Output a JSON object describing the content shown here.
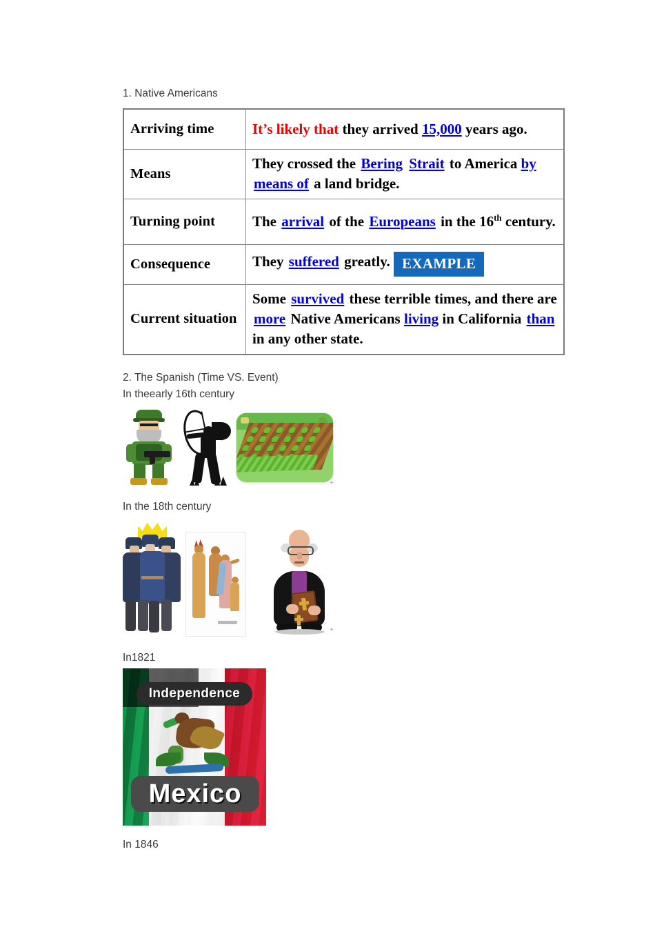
{
  "document": {
    "section1": {
      "heading": "1. Native Americans",
      "table": {
        "rows": [
          {
            "label": "Arriving time",
            "segments": [
              {
                "text": "It’s likely that",
                "style": "red-bold"
              },
              {
                "text": " they arrived ",
                "style": "plain"
              },
              {
                "text": "15,000",
                "style": "blank"
              },
              {
                "text": " years ago.",
                "style": "plain"
              }
            ]
          },
          {
            "label": "Means",
            "segments": [
              {
                "text": "They crossed the ",
                "style": "plain"
              },
              {
                "text": "Bering",
                "style": "blank"
              },
              {
                "text": " ",
                "style": "plain"
              },
              {
                "text": "Strait",
                "style": "blank"
              },
              {
                "text": " to America ",
                "style": "plain"
              },
              {
                "text": "by",
                "style": "blank"
              },
              {
                "text": "  ",
                "style": "plain"
              },
              {
                "text": "means of",
                "style": "blank"
              },
              {
                "text": " a land bridge.",
                "style": "plain"
              }
            ]
          },
          {
            "label": "Turning point",
            "segments": [
              {
                "text": "The ",
                "style": "plain"
              },
              {
                "text": "arrival",
                "style": "blank"
              },
              {
                "text": " of the ",
                "style": "plain"
              },
              {
                "text": "Europeans",
                "style": "blank"
              },
              {
                "text": " in the 16",
                "style": "plain"
              },
              {
                "text": "th",
                "style": "superscript"
              },
              {
                "text": " century.",
                "style": "plain"
              }
            ]
          },
          {
            "label": "Consequence",
            "segments": [
              {
                "text": "They ",
                "style": "plain"
              },
              {
                "text": "suffered",
                "style": "blank"
              },
              {
                "text": " greatly. ",
                "style": "plain"
              },
              {
                "text": "EXAMPLE",
                "style": "badge"
              }
            ]
          },
          {
            "label": "Current situation",
            "segments": [
              {
                "text": "Some ",
                "style": "plain"
              },
              {
                "text": "survived",
                "style": "blank"
              },
              {
                "text": " these terrible times, and there are ",
                "style": "plain"
              },
              {
                "text": "more",
                "style": "blank"
              },
              {
                "text": " Native Americans ",
                "style": "plain"
              },
              {
                "text": "living",
                "style": "blank"
              },
              {
                "text": " in California ",
                "style": "plain"
              },
              {
                "text": "than",
                "style": "blank"
              },
              {
                "text": " in any other state.",
                "style": "plain"
              }
            ]
          }
        ]
      }
    },
    "section2": {
      "heading": "2. The Spanish (Time VS. Event)",
      "entries": [
        {
          "time_label": "In theearly 16th century",
          "figures": [
            {
              "name": "soldier-clipart",
              "alt": "Pixel-art soldier in green camouflage holding a rifle"
            },
            {
              "name": "archer-silhouette-clipart",
              "alt": "Black silhouette of a Native American archer drawing a bow"
            },
            {
              "name": "farm-field-clipart",
              "alt": "Pixel-art green farm field with rows of crops"
            }
          ]
        },
        {
          "time_label": "In the 18th century",
          "figures": [
            {
              "name": "crowned-soldiers-clipart",
              "alt": "Three soldiers in blue uniforms beneath a yellow crown"
            },
            {
              "name": "native-family-illustration",
              "alt": "Drawing of a Native American family in traditional dress"
            },
            {
              "name": "priest-clipart",
              "alt": "Cartoon priest in black robe with purple stole holding a bible"
            }
          ]
        },
        {
          "time_label": "In1821",
          "figures": [
            {
              "name": "mexico-independence-flag",
              "alt": "Mexican flag image",
              "top_text": "Independence",
              "bottom_text": "Mexico"
            }
          ]
        },
        {
          "time_label": "In 1846",
          "figures": []
        }
      ]
    }
  },
  "colors": {
    "body_text": "#3c3c3c",
    "table_text": "#000000",
    "blank_answer": "#0000dd",
    "red_phrase": "#ee0000",
    "badge_background": "#1569bd",
    "badge_text": "#ffffff",
    "table_border": "#7a7a7a"
  }
}
